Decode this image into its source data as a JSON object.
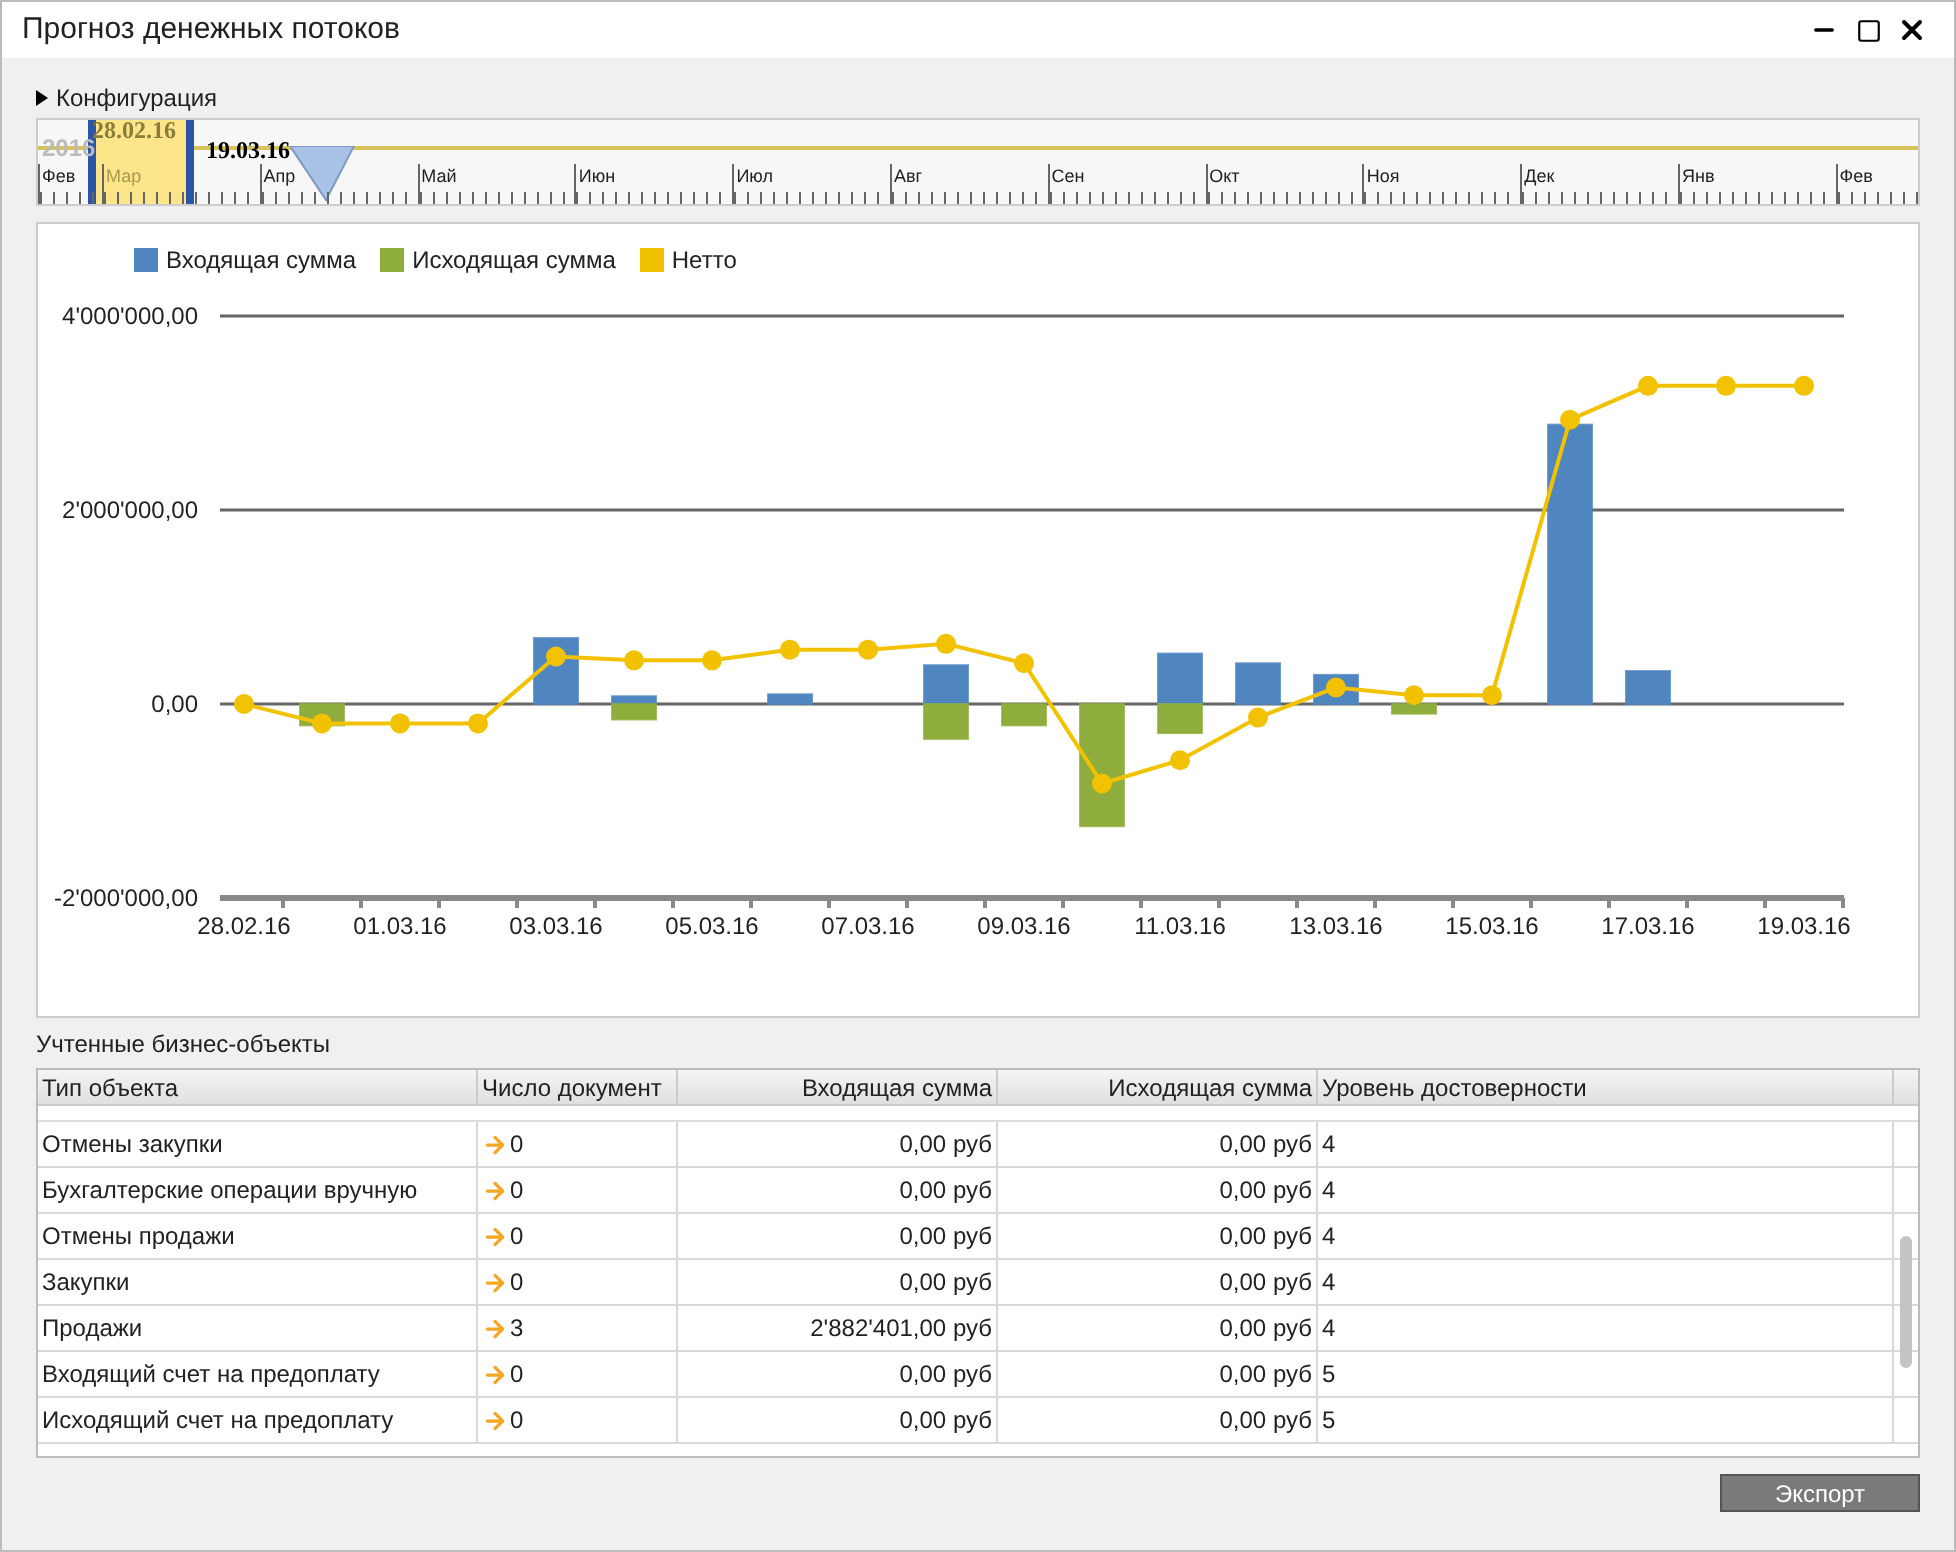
{
  "window": {
    "title": "Прогноз денежных потоков"
  },
  "configuration": {
    "label": "Конфигурация",
    "expanded": false
  },
  "timeline": {
    "year": "2016",
    "start": "28.02.16",
    "end": "19.03.16",
    "months": [
      "Фев",
      "Мар",
      "Апр",
      "Май",
      "Июн",
      "Июл",
      "Авг",
      "Сен",
      "Окт",
      "Ноя",
      "Дек",
      "Янв",
      "Фев"
    ]
  },
  "chart": {
    "chart_data": {
      "type": "bar",
      "categories": [
        "28.02.16",
        null,
        "01.03.16",
        null,
        "03.03.16",
        null,
        "05.03.16",
        null,
        "07.03.16",
        null,
        "09.03.16",
        null,
        "11.03.16",
        null,
        "13.03.16",
        null,
        "15.03.16",
        null,
        "17.03.16",
        null,
        "19.03.16"
      ],
      "stacked": true,
      "legend": "top",
      "ylim": [
        -2000000,
        4000000
      ],
      "yticks": [
        {
          "value": -2000000,
          "label": "-2'000'000,00"
        },
        {
          "value": 0,
          "label": "0,00"
        },
        {
          "value": 2000000,
          "label": "2'000'000,00"
        },
        {
          "value": 4000000,
          "label": "4'000'000,00"
        }
      ],
      "series": [
        {
          "name": "Входящая сумма",
          "color": "#4f86c0",
          "values": [
            null,
            null,
            null,
            null,
            680000,
            80000,
            null,
            100000,
            null,
            400000,
            null,
            null,
            520000,
            420000,
            300000,
            null,
            null,
            2880000,
            340000,
            null,
            null
          ]
        },
        {
          "name": "Исходящая сумма",
          "color": "#8fad3c",
          "values": [
            null,
            -220000,
            null,
            null,
            null,
            -160000,
            null,
            null,
            null,
            -360000,
            -220000,
            -1260000,
            -300000,
            null,
            null,
            -100000,
            null,
            null,
            null,
            null,
            null
          ]
        },
        {
          "name": "Нетто",
          "color": "#f2c200",
          "type": "line",
          "marker": "circle",
          "values": [
            0,
            -200000,
            -200000,
            -200000,
            490000,
            450000,
            450000,
            560000,
            560000,
            620000,
            420000,
            -820000,
            -580000,
            -140000,
            170000,
            90000,
            90000,
            2930000,
            3280000,
            3280000,
            3280000
          ]
        }
      ]
    }
  },
  "objects": {
    "title": "Учтенные бизнес-объекты",
    "columns": [
      "Тип объекта",
      "Число документ",
      "Входящая сумма",
      "Исходящая сумма",
      "Уровень достоверности"
    ],
    "rows": [
      [
        "Отмены закупки",
        "0",
        "0,00 руб",
        "0,00 руб",
        "4"
      ],
      [
        "Бухгалтерские операции вручную",
        "0",
        "0,00 руб",
        "0,00 руб",
        "4"
      ],
      [
        "Отмены продажи",
        "0",
        "0,00 руб",
        "0,00 руб",
        "4"
      ],
      [
        "Закупки",
        "0",
        "0,00 руб",
        "0,00 руб",
        "4"
      ],
      [
        "Продажи",
        "3",
        "2'882'401,00 руб",
        "0,00 руб",
        "4"
      ],
      [
        "Входящий счет на предоплату",
        "0",
        "0,00 руб",
        "0,00 руб",
        "5"
      ],
      [
        "Исходящий счет на предоплату",
        "0",
        "0,00 руб",
        "0,00 руб",
        "5"
      ]
    ]
  },
  "buttons": [
    "Экспорт"
  ]
}
